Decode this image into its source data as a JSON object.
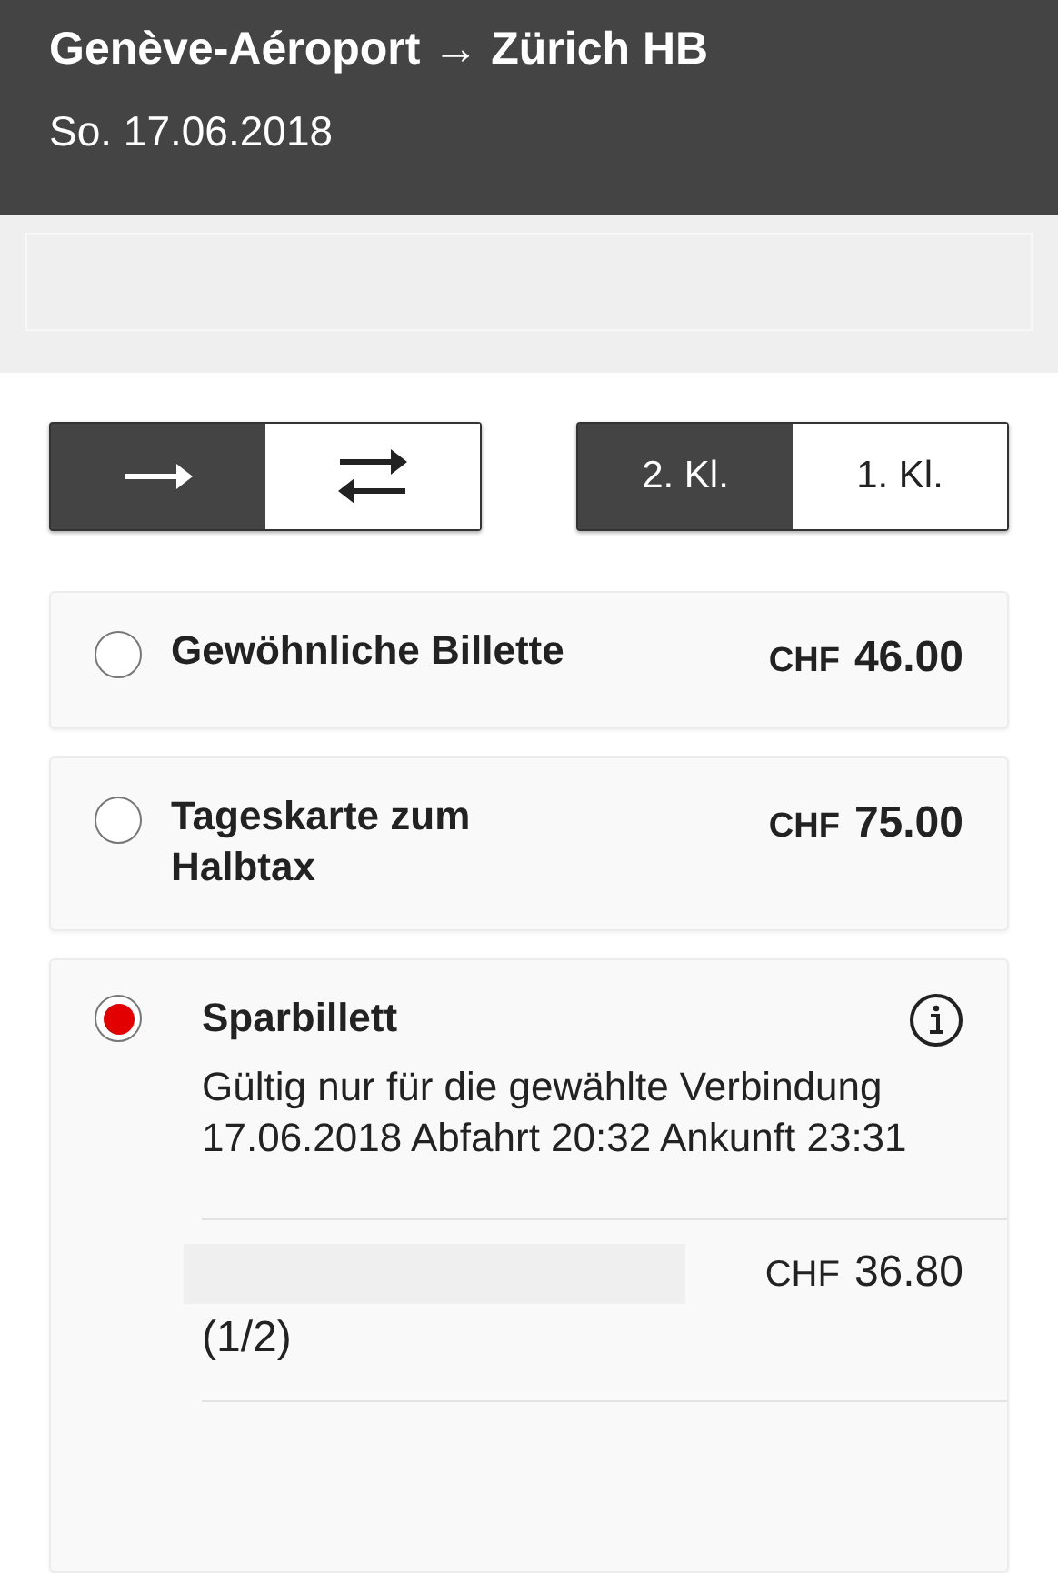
{
  "header": {
    "title": "Genève-Aéroport → Zürich HB",
    "date": "So. 17.06.2018"
  },
  "direction_toggle": [
    {
      "kind": "one-way",
      "selected": true
    },
    {
      "kind": "return",
      "selected": false
    }
  ],
  "class_toggle": [
    {
      "label": "2. Kl.",
      "selected": true
    },
    {
      "label": "1. Kl.",
      "selected": false
    }
  ],
  "offers": [
    {
      "kind": "simple",
      "title": "Gewöhnliche Billette",
      "currency": "CHF",
      "price": "46.00",
      "selected": false
    },
    {
      "kind": "simple",
      "title": "Tageskarte zum Halbtax",
      "currency": "CHF",
      "price": "75.00",
      "selected": false
    },
    {
      "kind": "detailed",
      "title": "Sparbillett",
      "selected": true,
      "description": [
        "Gültig nur für die gewählte Verbindung",
        "17.06.2018 Abfahrt 20:32 Ankunft 23:31"
      ],
      "items": [
        {
          "note": "(1/2)",
          "currency": "CHF",
          "price": "36.80"
        }
      ]
    }
  ]
}
